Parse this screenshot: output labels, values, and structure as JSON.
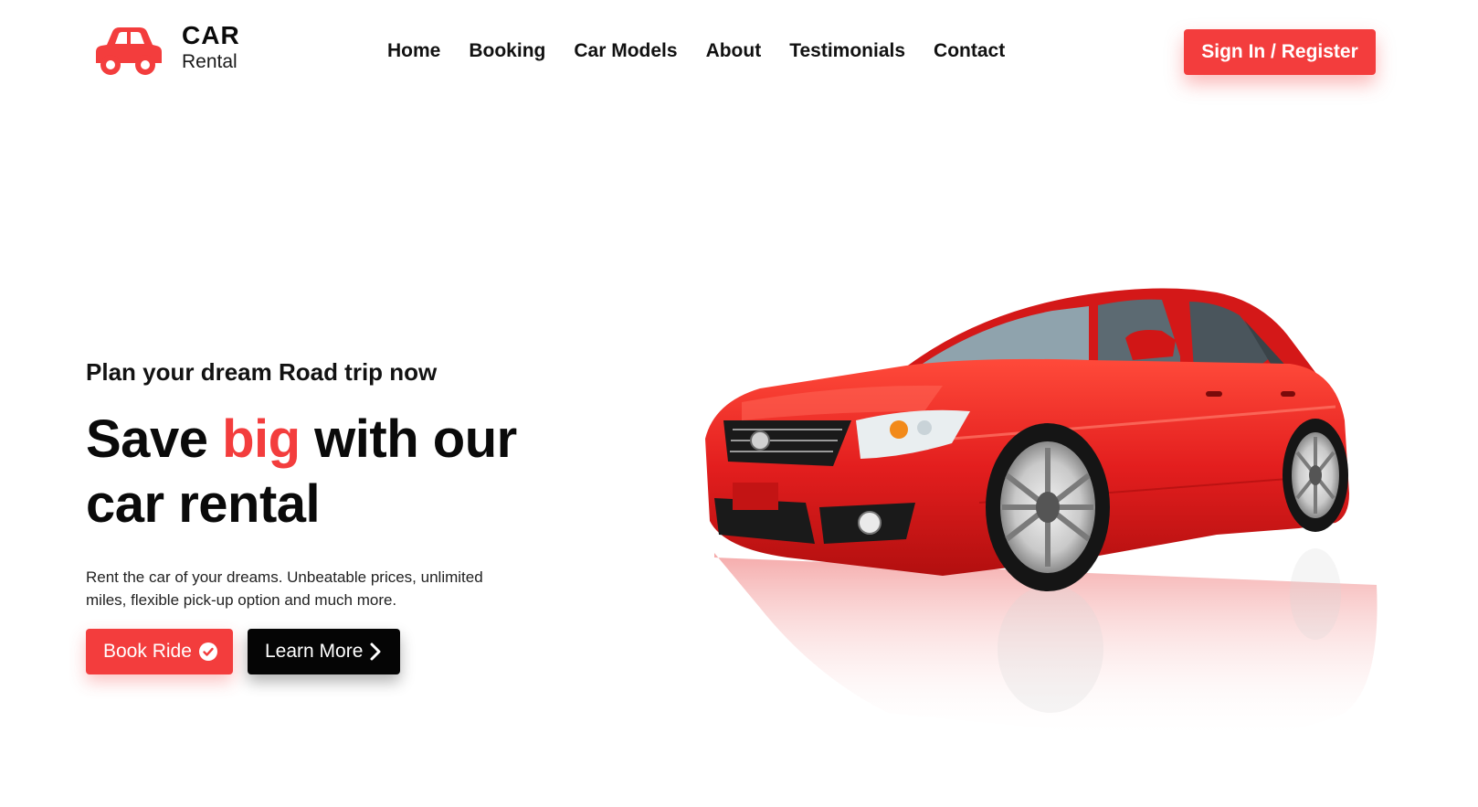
{
  "brand": {
    "title": "CAR",
    "subtitle": "Rental",
    "logo_icon": "car-icon",
    "accent_color": "#f33d3d"
  },
  "nav": {
    "items": [
      {
        "label": "Home"
      },
      {
        "label": "Booking"
      },
      {
        "label": "Car Models"
      },
      {
        "label": "About"
      },
      {
        "label": "Testimonials"
      },
      {
        "label": "Contact"
      }
    ]
  },
  "auth": {
    "signin_label": "Sign In / Register"
  },
  "hero": {
    "subheading": "Plan your dream Road trip now",
    "headline_before": "Save ",
    "headline_accent": "big",
    "headline_after": " with our car rental",
    "description": "Rent the car of your dreams. Unbeatable prices, unlimited miles, flexible pick-up option and much more.",
    "primary_button": {
      "label": "Book Ride",
      "icon": "check-circle-icon",
      "color": "#f33d3d"
    },
    "secondary_button": {
      "label": "Learn More",
      "icon": "chevron-right-icon",
      "color": "#050505"
    },
    "image": {
      "subject": "red-sedan",
      "color": "#e31e1e"
    }
  }
}
